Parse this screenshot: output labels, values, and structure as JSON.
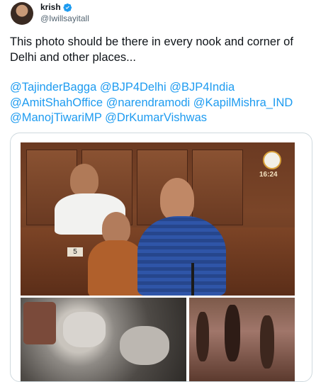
{
  "author": {
    "display_name": "krish",
    "handle": "@Iwillsayitall",
    "verified_color": "#1d9bf0"
  },
  "tweet": {
    "text_line1": "This photo should be there in every nook and corner of",
    "text_line2": "Delhi and other places...",
    "mentions_line1": "@TajinderBagga @BJP4Delhi @BJP4India",
    "mentions_line2": "@AmitShahOffice @narendramodi @KapilMishra_IND",
    "mentions_line3": "@ManojTiwariMP @DrKumarVishwas",
    "mention_color": "#1d9bf0"
  },
  "media": {
    "top_photo": {
      "clock_text": "16:24",
      "seat_number": "5"
    }
  }
}
